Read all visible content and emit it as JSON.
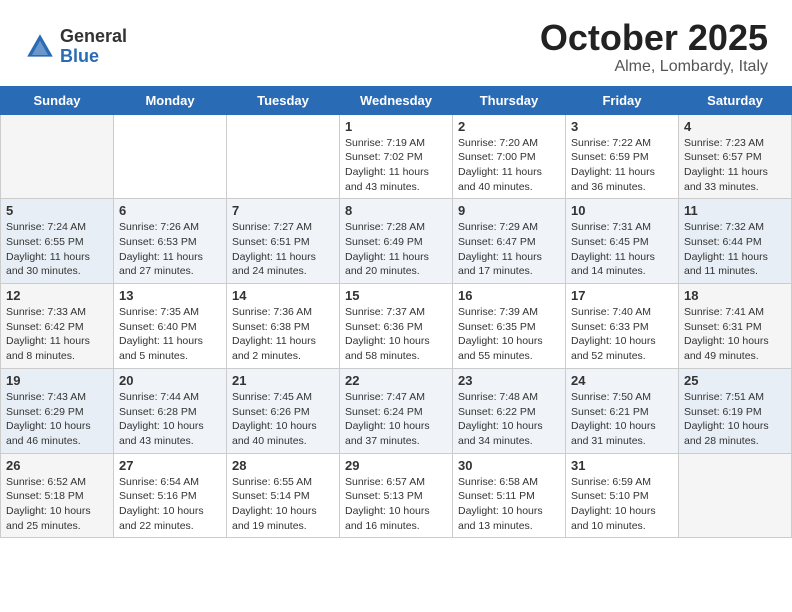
{
  "header": {
    "logo_general": "General",
    "logo_blue": "Blue",
    "month": "October 2025",
    "location": "Alme, Lombardy, Italy"
  },
  "weekdays": [
    "Sunday",
    "Monday",
    "Tuesday",
    "Wednesday",
    "Thursday",
    "Friday",
    "Saturday"
  ],
  "weeks": [
    [
      {
        "day": "",
        "info": ""
      },
      {
        "day": "",
        "info": ""
      },
      {
        "day": "",
        "info": ""
      },
      {
        "day": "1",
        "info": "Sunrise: 7:19 AM\nSunset: 7:02 PM\nDaylight: 11 hours\nand 43 minutes."
      },
      {
        "day": "2",
        "info": "Sunrise: 7:20 AM\nSunset: 7:00 PM\nDaylight: 11 hours\nand 40 minutes."
      },
      {
        "day": "3",
        "info": "Sunrise: 7:22 AM\nSunset: 6:59 PM\nDaylight: 11 hours\nand 36 minutes."
      },
      {
        "day": "4",
        "info": "Sunrise: 7:23 AM\nSunset: 6:57 PM\nDaylight: 11 hours\nand 33 minutes."
      }
    ],
    [
      {
        "day": "5",
        "info": "Sunrise: 7:24 AM\nSunset: 6:55 PM\nDaylight: 11 hours\nand 30 minutes."
      },
      {
        "day": "6",
        "info": "Sunrise: 7:26 AM\nSunset: 6:53 PM\nDaylight: 11 hours\nand 27 minutes."
      },
      {
        "day": "7",
        "info": "Sunrise: 7:27 AM\nSunset: 6:51 PM\nDaylight: 11 hours\nand 24 minutes."
      },
      {
        "day": "8",
        "info": "Sunrise: 7:28 AM\nSunset: 6:49 PM\nDaylight: 11 hours\nand 20 minutes."
      },
      {
        "day": "9",
        "info": "Sunrise: 7:29 AM\nSunset: 6:47 PM\nDaylight: 11 hours\nand 17 minutes."
      },
      {
        "day": "10",
        "info": "Sunrise: 7:31 AM\nSunset: 6:45 PM\nDaylight: 11 hours\nand 14 minutes."
      },
      {
        "day": "11",
        "info": "Sunrise: 7:32 AM\nSunset: 6:44 PM\nDaylight: 11 hours\nand 11 minutes."
      }
    ],
    [
      {
        "day": "12",
        "info": "Sunrise: 7:33 AM\nSunset: 6:42 PM\nDaylight: 11 hours\nand 8 minutes."
      },
      {
        "day": "13",
        "info": "Sunrise: 7:35 AM\nSunset: 6:40 PM\nDaylight: 11 hours\nand 5 minutes."
      },
      {
        "day": "14",
        "info": "Sunrise: 7:36 AM\nSunset: 6:38 PM\nDaylight: 11 hours\nand 2 minutes."
      },
      {
        "day": "15",
        "info": "Sunrise: 7:37 AM\nSunset: 6:36 PM\nDaylight: 10 hours\nand 58 minutes."
      },
      {
        "day": "16",
        "info": "Sunrise: 7:39 AM\nSunset: 6:35 PM\nDaylight: 10 hours\nand 55 minutes."
      },
      {
        "day": "17",
        "info": "Sunrise: 7:40 AM\nSunset: 6:33 PM\nDaylight: 10 hours\nand 52 minutes."
      },
      {
        "day": "18",
        "info": "Sunrise: 7:41 AM\nSunset: 6:31 PM\nDaylight: 10 hours\nand 49 minutes."
      }
    ],
    [
      {
        "day": "19",
        "info": "Sunrise: 7:43 AM\nSunset: 6:29 PM\nDaylight: 10 hours\nand 46 minutes."
      },
      {
        "day": "20",
        "info": "Sunrise: 7:44 AM\nSunset: 6:28 PM\nDaylight: 10 hours\nand 43 minutes."
      },
      {
        "day": "21",
        "info": "Sunrise: 7:45 AM\nSunset: 6:26 PM\nDaylight: 10 hours\nand 40 minutes."
      },
      {
        "day": "22",
        "info": "Sunrise: 7:47 AM\nSunset: 6:24 PM\nDaylight: 10 hours\nand 37 minutes."
      },
      {
        "day": "23",
        "info": "Sunrise: 7:48 AM\nSunset: 6:22 PM\nDaylight: 10 hours\nand 34 minutes."
      },
      {
        "day": "24",
        "info": "Sunrise: 7:50 AM\nSunset: 6:21 PM\nDaylight: 10 hours\nand 31 minutes."
      },
      {
        "day": "25",
        "info": "Sunrise: 7:51 AM\nSunset: 6:19 PM\nDaylight: 10 hours\nand 28 minutes."
      }
    ],
    [
      {
        "day": "26",
        "info": "Sunrise: 6:52 AM\nSunset: 5:18 PM\nDaylight: 10 hours\nand 25 minutes."
      },
      {
        "day": "27",
        "info": "Sunrise: 6:54 AM\nSunset: 5:16 PM\nDaylight: 10 hours\nand 22 minutes."
      },
      {
        "day": "28",
        "info": "Sunrise: 6:55 AM\nSunset: 5:14 PM\nDaylight: 10 hours\nand 19 minutes."
      },
      {
        "day": "29",
        "info": "Sunrise: 6:57 AM\nSunset: 5:13 PM\nDaylight: 10 hours\nand 16 minutes."
      },
      {
        "day": "30",
        "info": "Sunrise: 6:58 AM\nSunset: 5:11 PM\nDaylight: 10 hours\nand 13 minutes."
      },
      {
        "day": "31",
        "info": "Sunrise: 6:59 AM\nSunset: 5:10 PM\nDaylight: 10 hours\nand 10 minutes."
      },
      {
        "day": "",
        "info": ""
      }
    ]
  ]
}
